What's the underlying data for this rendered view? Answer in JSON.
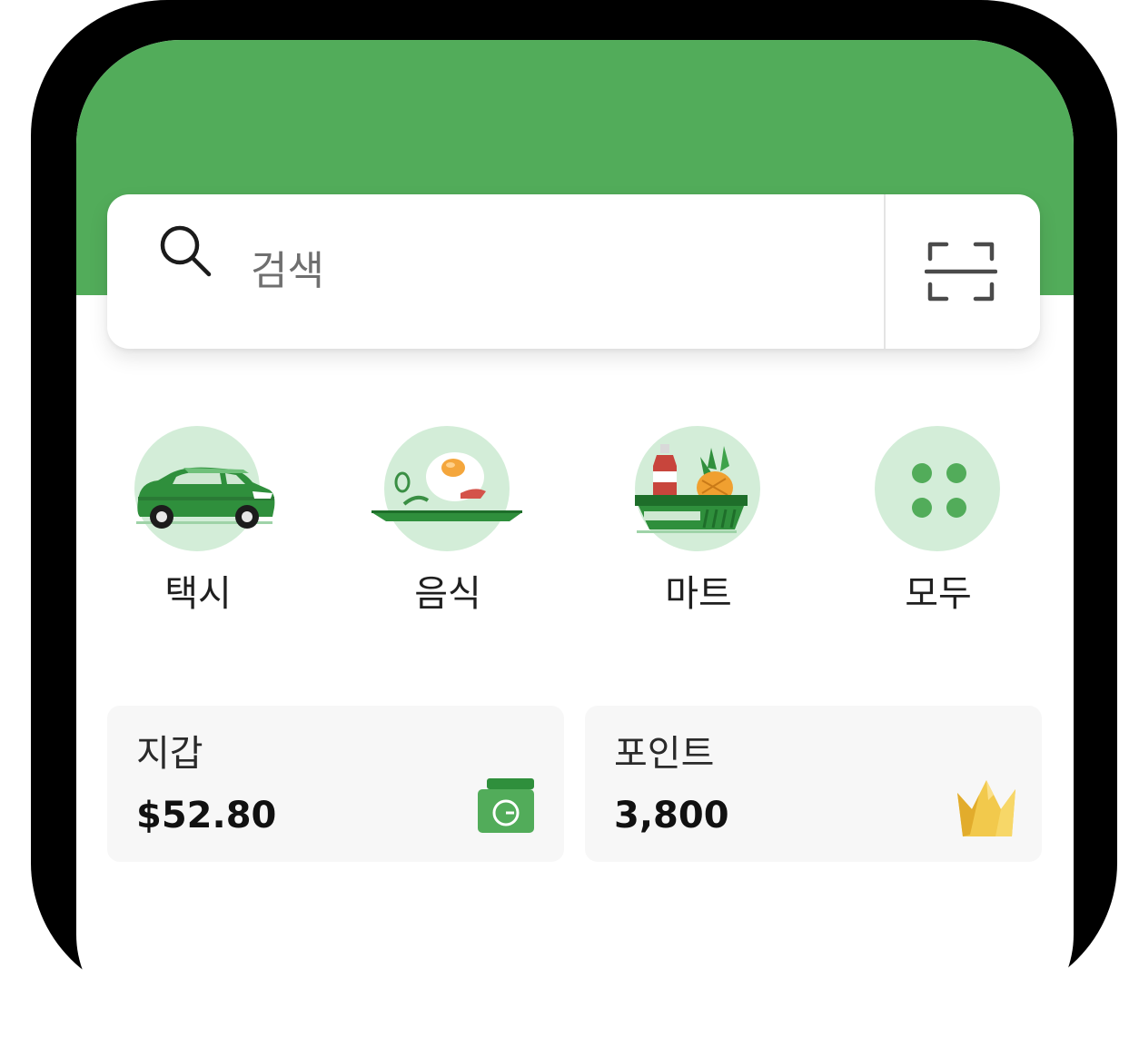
{
  "search": {
    "placeholder": "검색"
  },
  "categories": [
    {
      "label": "택시",
      "icon": "car-icon"
    },
    {
      "label": "음식",
      "icon": "food-plate-icon"
    },
    {
      "label": "마트",
      "icon": "grocery-basket-icon"
    },
    {
      "label": "모두",
      "icon": "all-services-grid-icon"
    }
  ],
  "wallet": {
    "title": "지갑",
    "value": "$52.80",
    "icon": "wallet-g-icon"
  },
  "points": {
    "title": "포인트",
    "value": "3,800",
    "icon": "crown-icon"
  },
  "colors": {
    "brand_green": "#52ac5a",
    "light_green": "#d3edd8",
    "crown_gold": "#f2c94c"
  }
}
